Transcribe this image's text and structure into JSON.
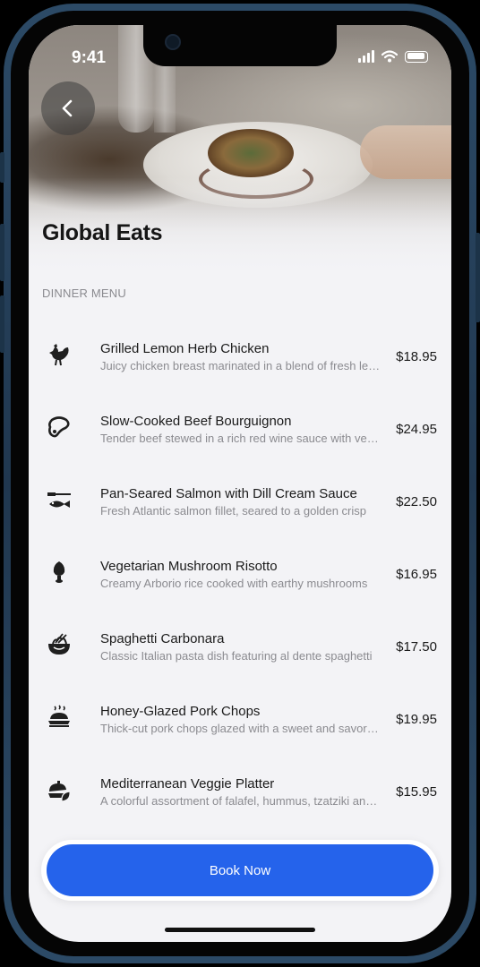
{
  "status_bar": {
    "time": "9:41"
  },
  "header": {
    "title": "Global Eats"
  },
  "section": {
    "label": "DINNER MENU"
  },
  "menu": {
    "items": [
      {
        "icon": "rooster-icon",
        "name": "Grilled Lemon Herb Chicken",
        "description": "Juicy chicken breast marinated in a blend of fresh lemon and herbs",
        "price": "$18.95"
      },
      {
        "icon": "steak-icon",
        "name": "Slow-Cooked Beef Bourguignon",
        "description": "Tender beef stewed in a rich red wine sauce with vegetables",
        "price": "$24.95"
      },
      {
        "icon": "fish-knife-icon",
        "name": "Pan-Seared Salmon with Dill Cream Sauce",
        "description": "Fresh Atlantic salmon fillet, seared to a golden crisp",
        "price": "$22.50"
      },
      {
        "icon": "mushroom-icon",
        "name": "Vegetarian Mushroom Risotto",
        "description": "Creamy Arborio rice cooked with earthy mushrooms",
        "price": "$16.95"
      },
      {
        "icon": "noodle-bowl-icon",
        "name": "Spaghetti Carbonara",
        "description": "Classic Italian pasta dish featuring al dente spaghetti",
        "price": "$17.50"
      },
      {
        "icon": "roast-dish-icon",
        "name": "Honey-Glazed Pork Chops",
        "description": "Thick-cut pork chops glazed with a sweet and savory honey",
        "price": "$19.95"
      },
      {
        "icon": "veggie-platter-icon",
        "name": "Mediterranean Veggie Platter",
        "description": "A colorful assortment of falafel, hummus, tzatziki and pita",
        "price": "$15.95"
      }
    ]
  },
  "cta": {
    "label": "Book Now",
    "color": "#2563eb"
  }
}
